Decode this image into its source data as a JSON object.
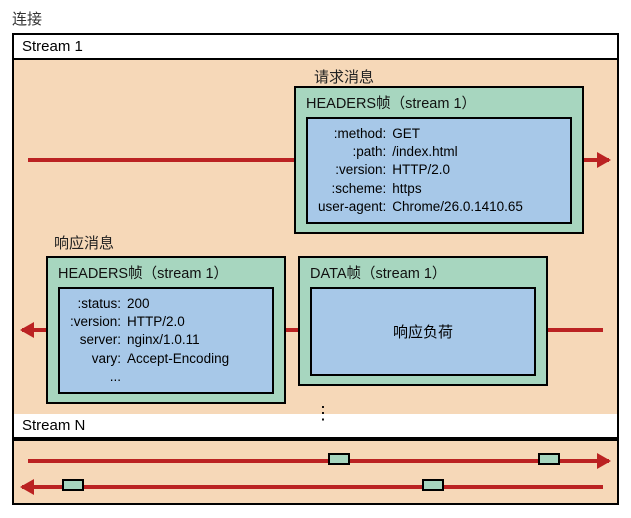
{
  "connection_label": "连接",
  "stream1": {
    "header": "Stream 1",
    "request_label": "请求消息",
    "response_label": "响应消息",
    "request_frame": {
      "title": "HEADERS帧（stream 1）",
      "fields": [
        {
          "k": ":method:",
          "v": "GET"
        },
        {
          "k": ":path:",
          "v": "/index.html"
        },
        {
          "k": ":version:",
          "v": "HTTP/2.0"
        },
        {
          "k": ":scheme:",
          "v": "https"
        },
        {
          "k": "user-agent:",
          "v": "Chrome/26.0.1410.65"
        }
      ]
    },
    "response_headers_frame": {
      "title": "HEADERS帧（stream 1）",
      "fields": [
        {
          "k": ":status:",
          "v": "200"
        },
        {
          "k": ":version:",
          "v": "HTTP/2.0"
        },
        {
          "k": "server:",
          "v": "nginx/1.0.11"
        },
        {
          "k": "vary:",
          "v": "Accept-Encoding"
        },
        {
          "k": "...",
          "v": ""
        }
      ]
    },
    "response_data_frame": {
      "title": "DATA帧（stream 1）",
      "payload": "响应负荷"
    }
  },
  "streamN": {
    "header": "Stream N"
  }
}
